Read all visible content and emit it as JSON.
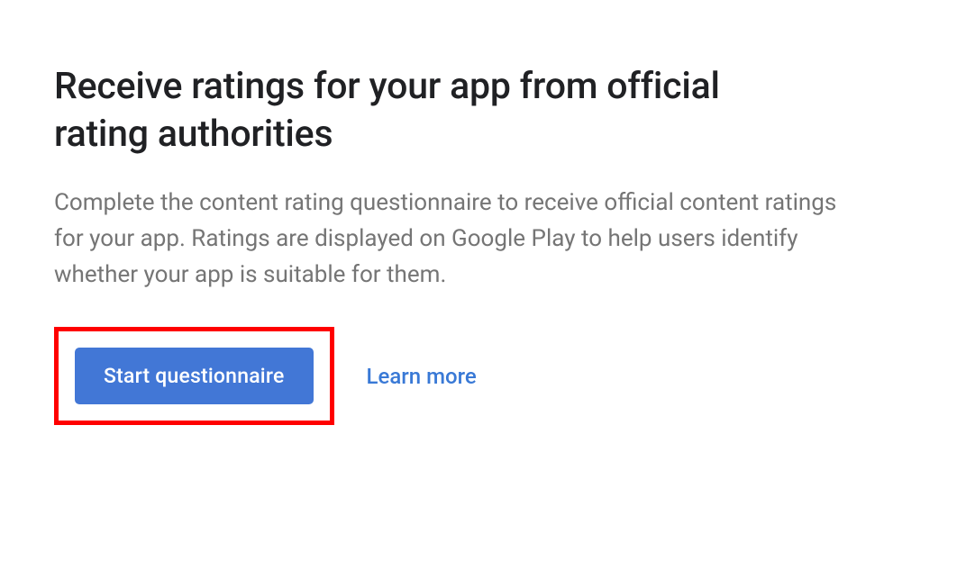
{
  "heading": "Receive ratings for your app from official rating authorities",
  "description": "Complete the content rating questionnaire to receive official content ratings for your app. Ratings are displayed on Google Play to help users identify whether your app is suitable for them.",
  "primary_button_label": "Start questionnaire",
  "learn_more_label": "Learn more",
  "colors": {
    "primary": "#4277d6",
    "link": "#3979d6",
    "text_heading": "#202124",
    "text_body": "#757575",
    "highlight_border": "#ff0000"
  }
}
